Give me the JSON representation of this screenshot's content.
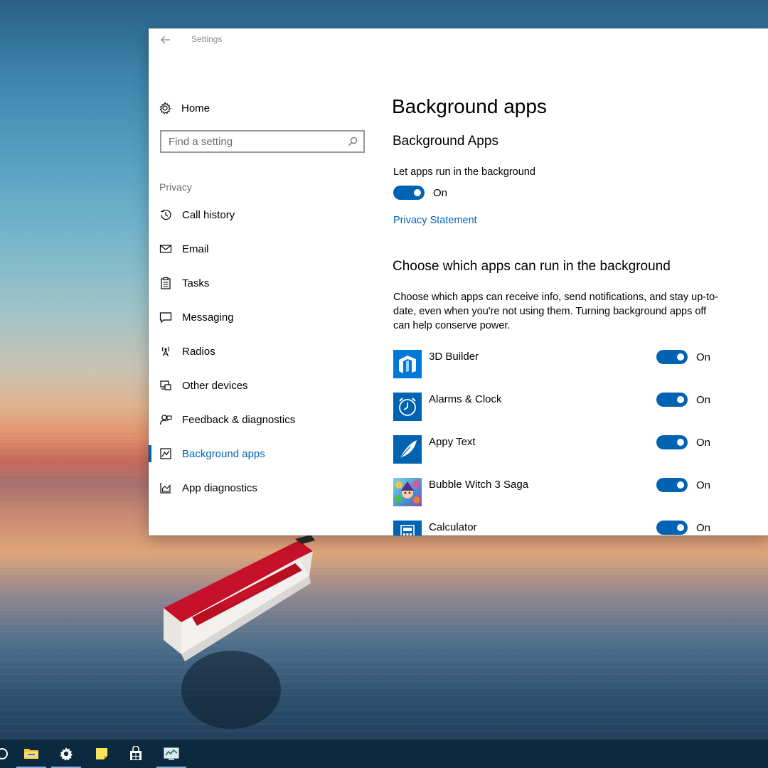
{
  "window": {
    "title": "Settings"
  },
  "nav": {
    "home_label": "Home",
    "search_placeholder": "Find a setting",
    "group_label": "Privacy",
    "items": [
      {
        "label": "Call history",
        "icon": "history-icon"
      },
      {
        "label": "Email",
        "icon": "mail-icon"
      },
      {
        "label": "Tasks",
        "icon": "clipboard-icon"
      },
      {
        "label": "Messaging",
        "icon": "chat-icon"
      },
      {
        "label": "Radios",
        "icon": "antenna-icon"
      },
      {
        "label": "Other devices",
        "icon": "devices-icon"
      },
      {
        "label": "Feedback & diagnostics",
        "icon": "feedback-icon"
      },
      {
        "label": "Background apps",
        "icon": "background-apps-icon",
        "selected": true
      },
      {
        "label": "App diagnostics",
        "icon": "diagnostics-icon"
      }
    ]
  },
  "content": {
    "page_title": "Background apps",
    "section1_title": "Background Apps",
    "let_apps_label": "Let apps run in the background",
    "master_toggle": {
      "state": "On",
      "on": true
    },
    "privacy_link": "Privacy Statement",
    "section2_title": "Choose which apps can run in the background",
    "description": "Choose which apps can receive info, send notifications, and stay up-to-date, even when you're not using them. Turning background apps off can help conserve power.",
    "apps": [
      {
        "name": "3D Builder",
        "state": "On",
        "icon": "3d-builder-icon"
      },
      {
        "name": "Alarms & Clock",
        "state": "On",
        "icon": "alarm-clock-icon"
      },
      {
        "name": "Appy Text",
        "state": "On",
        "icon": "feather-icon"
      },
      {
        "name": "Bubble Witch 3 Saga",
        "state": "On",
        "icon": "bubble-witch-icon"
      },
      {
        "name": "Calculator",
        "state": "On",
        "icon": "calculator-icon"
      }
    ]
  },
  "colors": {
    "accent": "#0063b1",
    "taskbar": "#0c2a3f"
  },
  "taskbar": {
    "items": [
      "cortana-icon",
      "file-explorer-icon",
      "settings-gear-icon",
      "sticky-notes-icon",
      "store-icon",
      "task-manager-icon"
    ]
  }
}
